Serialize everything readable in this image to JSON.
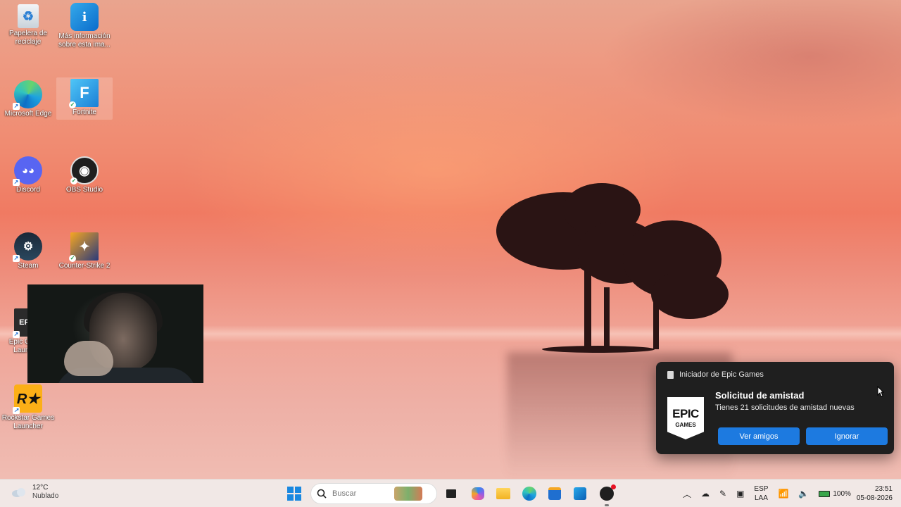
{
  "desktop": {
    "icons": [
      {
        "label": "Papelera de reciclaje",
        "icon": "recycle-bin-icon"
      },
      {
        "label": "Más información sobre esta ima...",
        "icon": "spotlight-info-icon"
      },
      {
        "label": "Microsoft Edge",
        "icon": "edge-icon"
      },
      {
        "label": "Fortnite",
        "icon": "fortnite-icon"
      },
      {
        "label": "Discord",
        "icon": "discord-icon"
      },
      {
        "label": "OBS Studio",
        "icon": "obs-icon"
      },
      {
        "label": "Steam",
        "icon": "steam-icon"
      },
      {
        "label": "Counter-Strike 2",
        "icon": "cs2-icon"
      },
      {
        "label": "Epic Games Launcher",
        "icon": "epic-icon"
      },
      {
        "label": "Rockstar Games Launcher",
        "icon": "rockstar-icon"
      }
    ]
  },
  "notification": {
    "app_name": "Iniciador de Epic Games",
    "logo_line1": "EPIC",
    "logo_line2": "GAMES",
    "title": "Solicitud de amistad",
    "body": "Tienes 21 solicitudes de amistad nuevas",
    "primary_button": "Ver amigos",
    "secondary_button": "Ignorar"
  },
  "taskbar": {
    "weather_temp": "12°C",
    "weather_condition": "Nublado",
    "search_placeholder": "Buscar",
    "language_line1": "ESP",
    "language_line2": "LAA",
    "battery_percent": "100%",
    "time": "23:51",
    "date": "05-08-2026"
  },
  "colors": {
    "accent_button": "#1d7ae0",
    "toast_bg": "#1f1f1f",
    "taskbar_bg": "#f1e8e6"
  }
}
